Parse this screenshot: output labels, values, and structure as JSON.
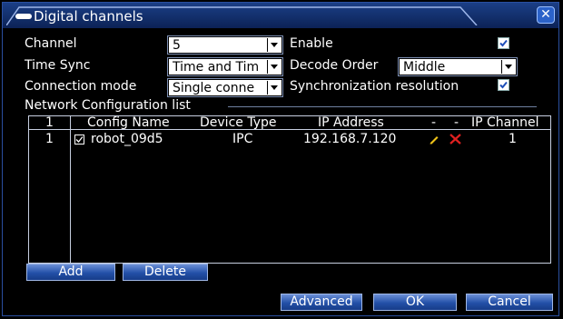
{
  "window": {
    "title": "Digital channels",
    "close_label": "✕"
  },
  "form": {
    "channel_label": "Channel",
    "channel_value": "5",
    "enable_label": "Enable",
    "enable_checked": true,
    "time_sync_label": "Time Sync",
    "time_sync_value": "Time and Tim",
    "decode_order_label": "Decode Order",
    "decode_order_value": "Middle",
    "connection_mode_label": "Connection mode",
    "connection_mode_value": "Single conne",
    "sync_resolution_label": "Synchronization resolution",
    "sync_resolution_checked": true
  },
  "network_list": {
    "section_title": "Network Configuration list",
    "headers": {
      "index": "1",
      "config_name": "Config Name",
      "device_type": "Device Type",
      "ip_address": "IP Address",
      "edit": "-",
      "delete": "-",
      "ip_channel": "IP Channel"
    },
    "rows": [
      {
        "index": "1",
        "checked": true,
        "config_name": "robot_09d5",
        "device_type": "IPC",
        "ip_address": "192.168.7.120",
        "edit_icon": "pencil-icon",
        "delete_icon": "red-x-icon",
        "ip_channel": "1"
      }
    ]
  },
  "buttons": {
    "add": "Add",
    "delete": "Delete",
    "advanced": "Advanced",
    "ok": "OK",
    "cancel": "Cancel"
  },
  "colors": {
    "title_bar": "#1b3f86",
    "button": "#2350a8",
    "check": "#1e4fb8",
    "delete_x": "#e02020",
    "edit_pencil": "#f0c419"
  }
}
